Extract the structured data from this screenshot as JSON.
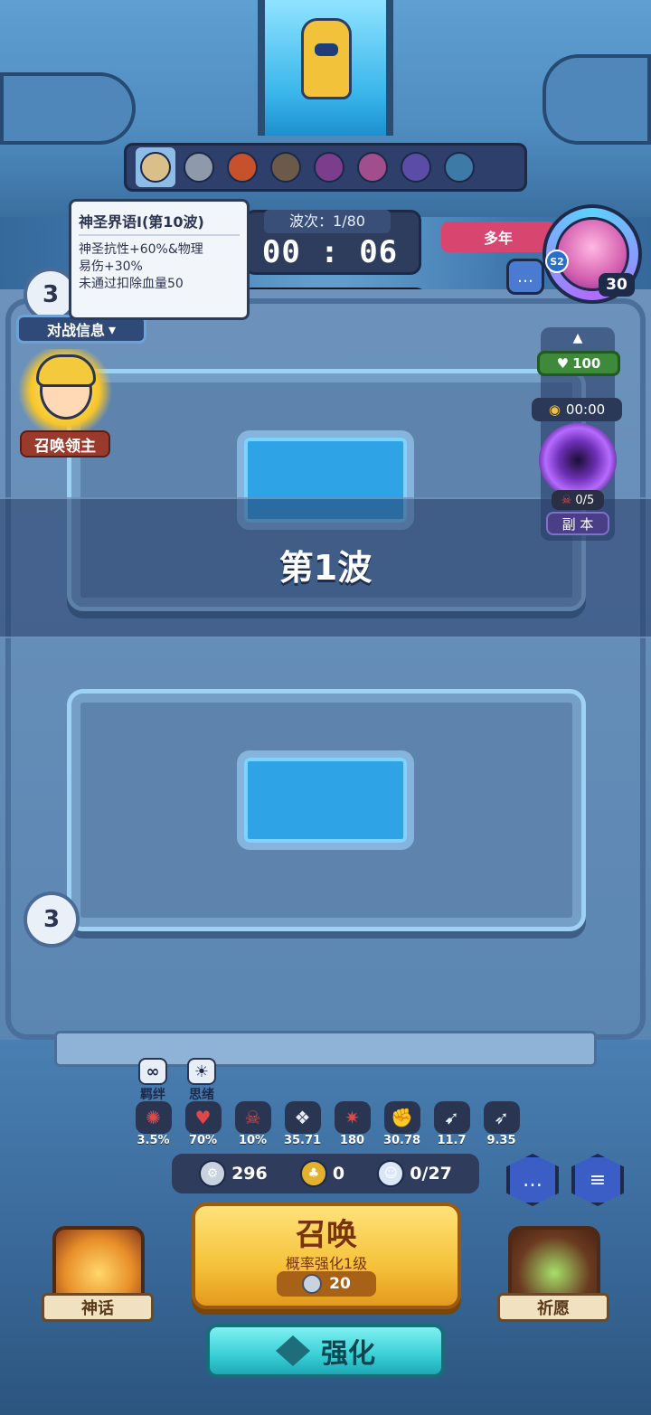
{
  "monsters": {
    "items": [
      {
        "name": "wings-icon",
        "color": "#d9c08a",
        "selected": true
      },
      {
        "name": "robot-monster-icon",
        "color": "#8e9aaa"
      },
      {
        "name": "fire-monster-icon",
        "color": "#c7502d"
      },
      {
        "name": "eagle-monster-icon",
        "color": "#6b5a4a"
      },
      {
        "name": "twin-monster-icon",
        "color": "#7b3d8c"
      },
      {
        "name": "twin-monster-icon",
        "color": "#a04f8c"
      },
      {
        "name": "twin-monster-icon",
        "color": "#5b4ca8"
      },
      {
        "name": "twin-monster-icon",
        "color": "#3d7aa8"
      }
    ]
  },
  "wave": {
    "label": "波次：1/80",
    "timer": "00 : 06",
    "banner": "第1波"
  },
  "tooltip": {
    "title": "神圣界语Ⅰ(第10波)",
    "line1": "神圣抗性+60%&物理",
    "line2": "易伤+30%",
    "line3": "未通过扣除血量50"
  },
  "player_left": {
    "level": "3",
    "battle_info": "对战信息",
    "lord_label": "召唤领主"
  },
  "player_right": {
    "tag": "多年",
    "season": "S2",
    "level": "30"
  },
  "dungeon": {
    "hp": "100",
    "time": "00:00",
    "kills": "0/5",
    "label": "副 本"
  },
  "lives": "3",
  "tags": [
    {
      "label": "羁绊",
      "icon": "bond-icon"
    },
    {
      "label": "思绪",
      "icon": "lightbulb-icon"
    }
  ],
  "buffs": [
    {
      "value": "3.5%",
      "icon": "crit-icon",
      "color": "#e04848"
    },
    {
      "value": "70%",
      "icon": "heart-icon",
      "color": "#e04848"
    },
    {
      "value": "10%",
      "icon": "skull-icon",
      "color": "#e04848"
    },
    {
      "value": "35.71",
      "icon": "wing-icon",
      "color": "#e8eef8"
    },
    {
      "value": "180",
      "icon": "burst-icon",
      "color": "#e04848"
    },
    {
      "value": "30.78",
      "icon": "fist-icon",
      "color": "#e8eef8"
    },
    {
      "value": "11.7",
      "icon": "speed-icon",
      "color": "#e8eef8"
    },
    {
      "value": "9.35",
      "icon": "bow-icon",
      "color": "#e8eef8"
    }
  ],
  "resources": {
    "silver": "296",
    "luck": "0",
    "souls": "0/27"
  },
  "summon": {
    "title": "召唤",
    "subtitle": "概率强化1级",
    "cost": "20"
  },
  "upgrade": {
    "label": "强化"
  },
  "cards": {
    "myth": "神话",
    "wish": "祈愿"
  }
}
